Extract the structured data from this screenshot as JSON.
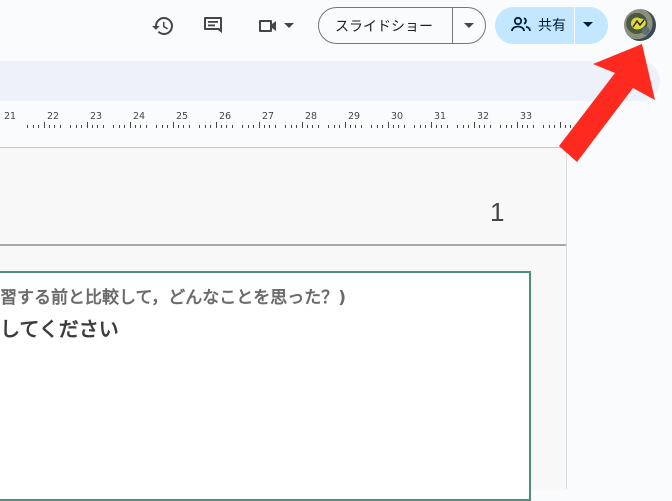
{
  "header": {
    "slideshow_label": "スライドショー",
    "share_label": "共有",
    "icons": [
      "history-icon",
      "comment-icon",
      "video-camera-icon"
    ]
  },
  "ruler": {
    "numbers": [
      "21",
      "22",
      "23",
      "24",
      "25",
      "26",
      "27",
      "28",
      "29",
      "30",
      "31",
      "32",
      "33"
    ]
  },
  "slide": {
    "number": "1",
    "question": "習する前と比較して，どんなことを思った？)",
    "prompt": "してください"
  },
  "colors": {
    "share_bg": "#c2e7ff",
    "textbox_border": "#4e8f80",
    "annotation_arrow": "#ff2a1f"
  }
}
